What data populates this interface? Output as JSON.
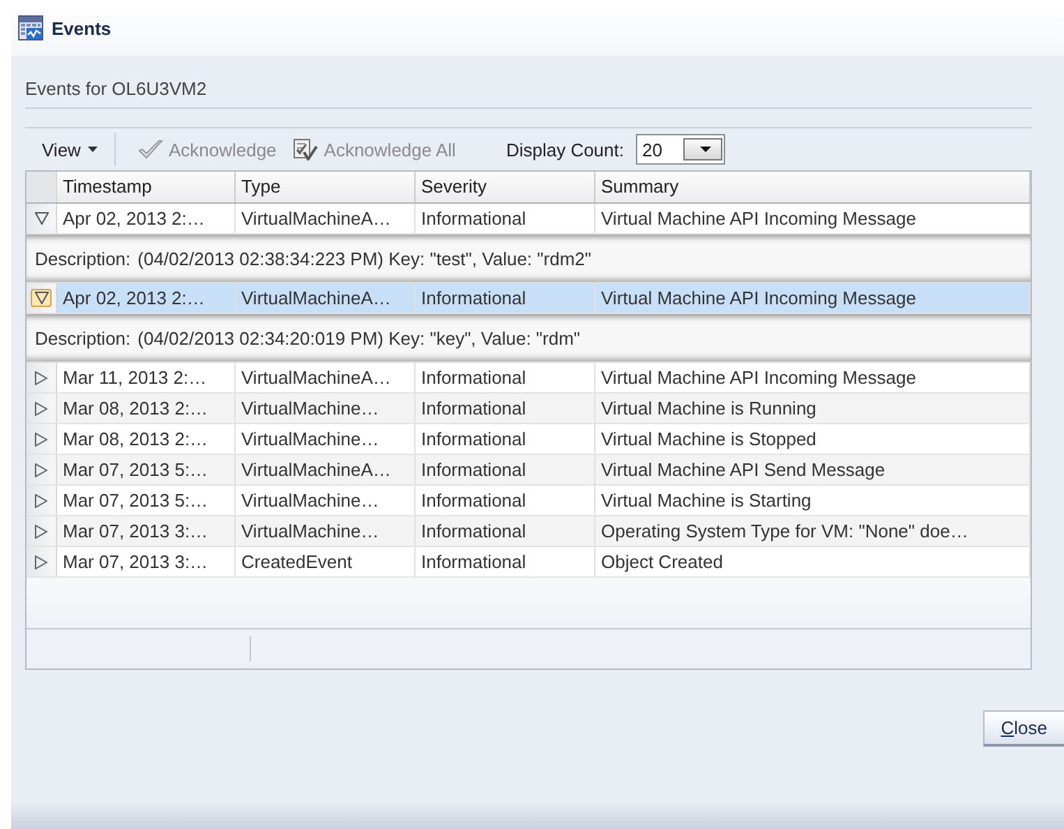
{
  "window": {
    "title": "Events"
  },
  "heading": "Events for OL6U3VM2",
  "toolbar": {
    "view_menu": "View",
    "actions": [
      {
        "label": "Acknowledge",
        "disabled": true
      },
      {
        "label": "Acknowledge All",
        "disabled": true
      }
    ],
    "display_count": {
      "label": "Display Count:",
      "value": "20"
    }
  },
  "table": {
    "columns": [
      "Timestamp",
      "Type",
      "Severity",
      "Summary"
    ],
    "rows": [
      {
        "timestamp": "Apr 02, 2013 2:…",
        "type": "VirtualMachineA…",
        "severity": "Informational",
        "summary": "Virtual Machine API Incoming Message",
        "expanded": true,
        "selected": false,
        "description": {
          "label": "Description:",
          "text": "(04/02/2013 02:38:34:223 PM) Key: \"test\", Value: \"rdm2\""
        }
      },
      {
        "timestamp": "Apr 02, 2013 2:…",
        "type": "VirtualMachineA…",
        "severity": "Informational",
        "summary": "Virtual Machine API Incoming Message",
        "expanded": true,
        "selected": true,
        "description": {
          "label": "Description:",
          "text": "(04/02/2013 02:34:20:019 PM) Key: \"key\", Value: \"rdm\""
        }
      },
      {
        "timestamp": "Mar 11, 2013 2:…",
        "type": "VirtualMachineA…",
        "severity": "Informational",
        "summary": "Virtual Machine API Incoming Message",
        "expanded": false,
        "selected": false
      },
      {
        "timestamp": "Mar 08, 2013 2:…",
        "type": "VirtualMachine…",
        "severity": "Informational",
        "summary": "Virtual Machine is Running",
        "expanded": false,
        "selected": false
      },
      {
        "timestamp": "Mar 08, 2013 2:…",
        "type": "VirtualMachine…",
        "severity": "Informational",
        "summary": "Virtual Machine is Stopped",
        "expanded": false,
        "selected": false
      },
      {
        "timestamp": "Mar 07, 2013 5:…",
        "type": "VirtualMachineA…",
        "severity": "Informational",
        "summary": "Virtual Machine API Send Message",
        "expanded": false,
        "selected": false
      },
      {
        "timestamp": "Mar 07, 2013 5:…",
        "type": "VirtualMachine…",
        "severity": "Informational",
        "summary": "Virtual Machine is Starting",
        "expanded": false,
        "selected": false
      },
      {
        "timestamp": "Mar 07, 2013 3:…",
        "type": "VirtualMachine…",
        "severity": "Informational",
        "summary": "Operating System Type for VM: \"None\" doe…",
        "expanded": false,
        "selected": false
      },
      {
        "timestamp": "Mar 07, 2013 3:…",
        "type": "CreatedEvent",
        "severity": "Informational",
        "summary": "Object Created",
        "expanded": false,
        "selected": false
      }
    ]
  },
  "buttons": [
    {
      "label": "Close"
    }
  ]
}
